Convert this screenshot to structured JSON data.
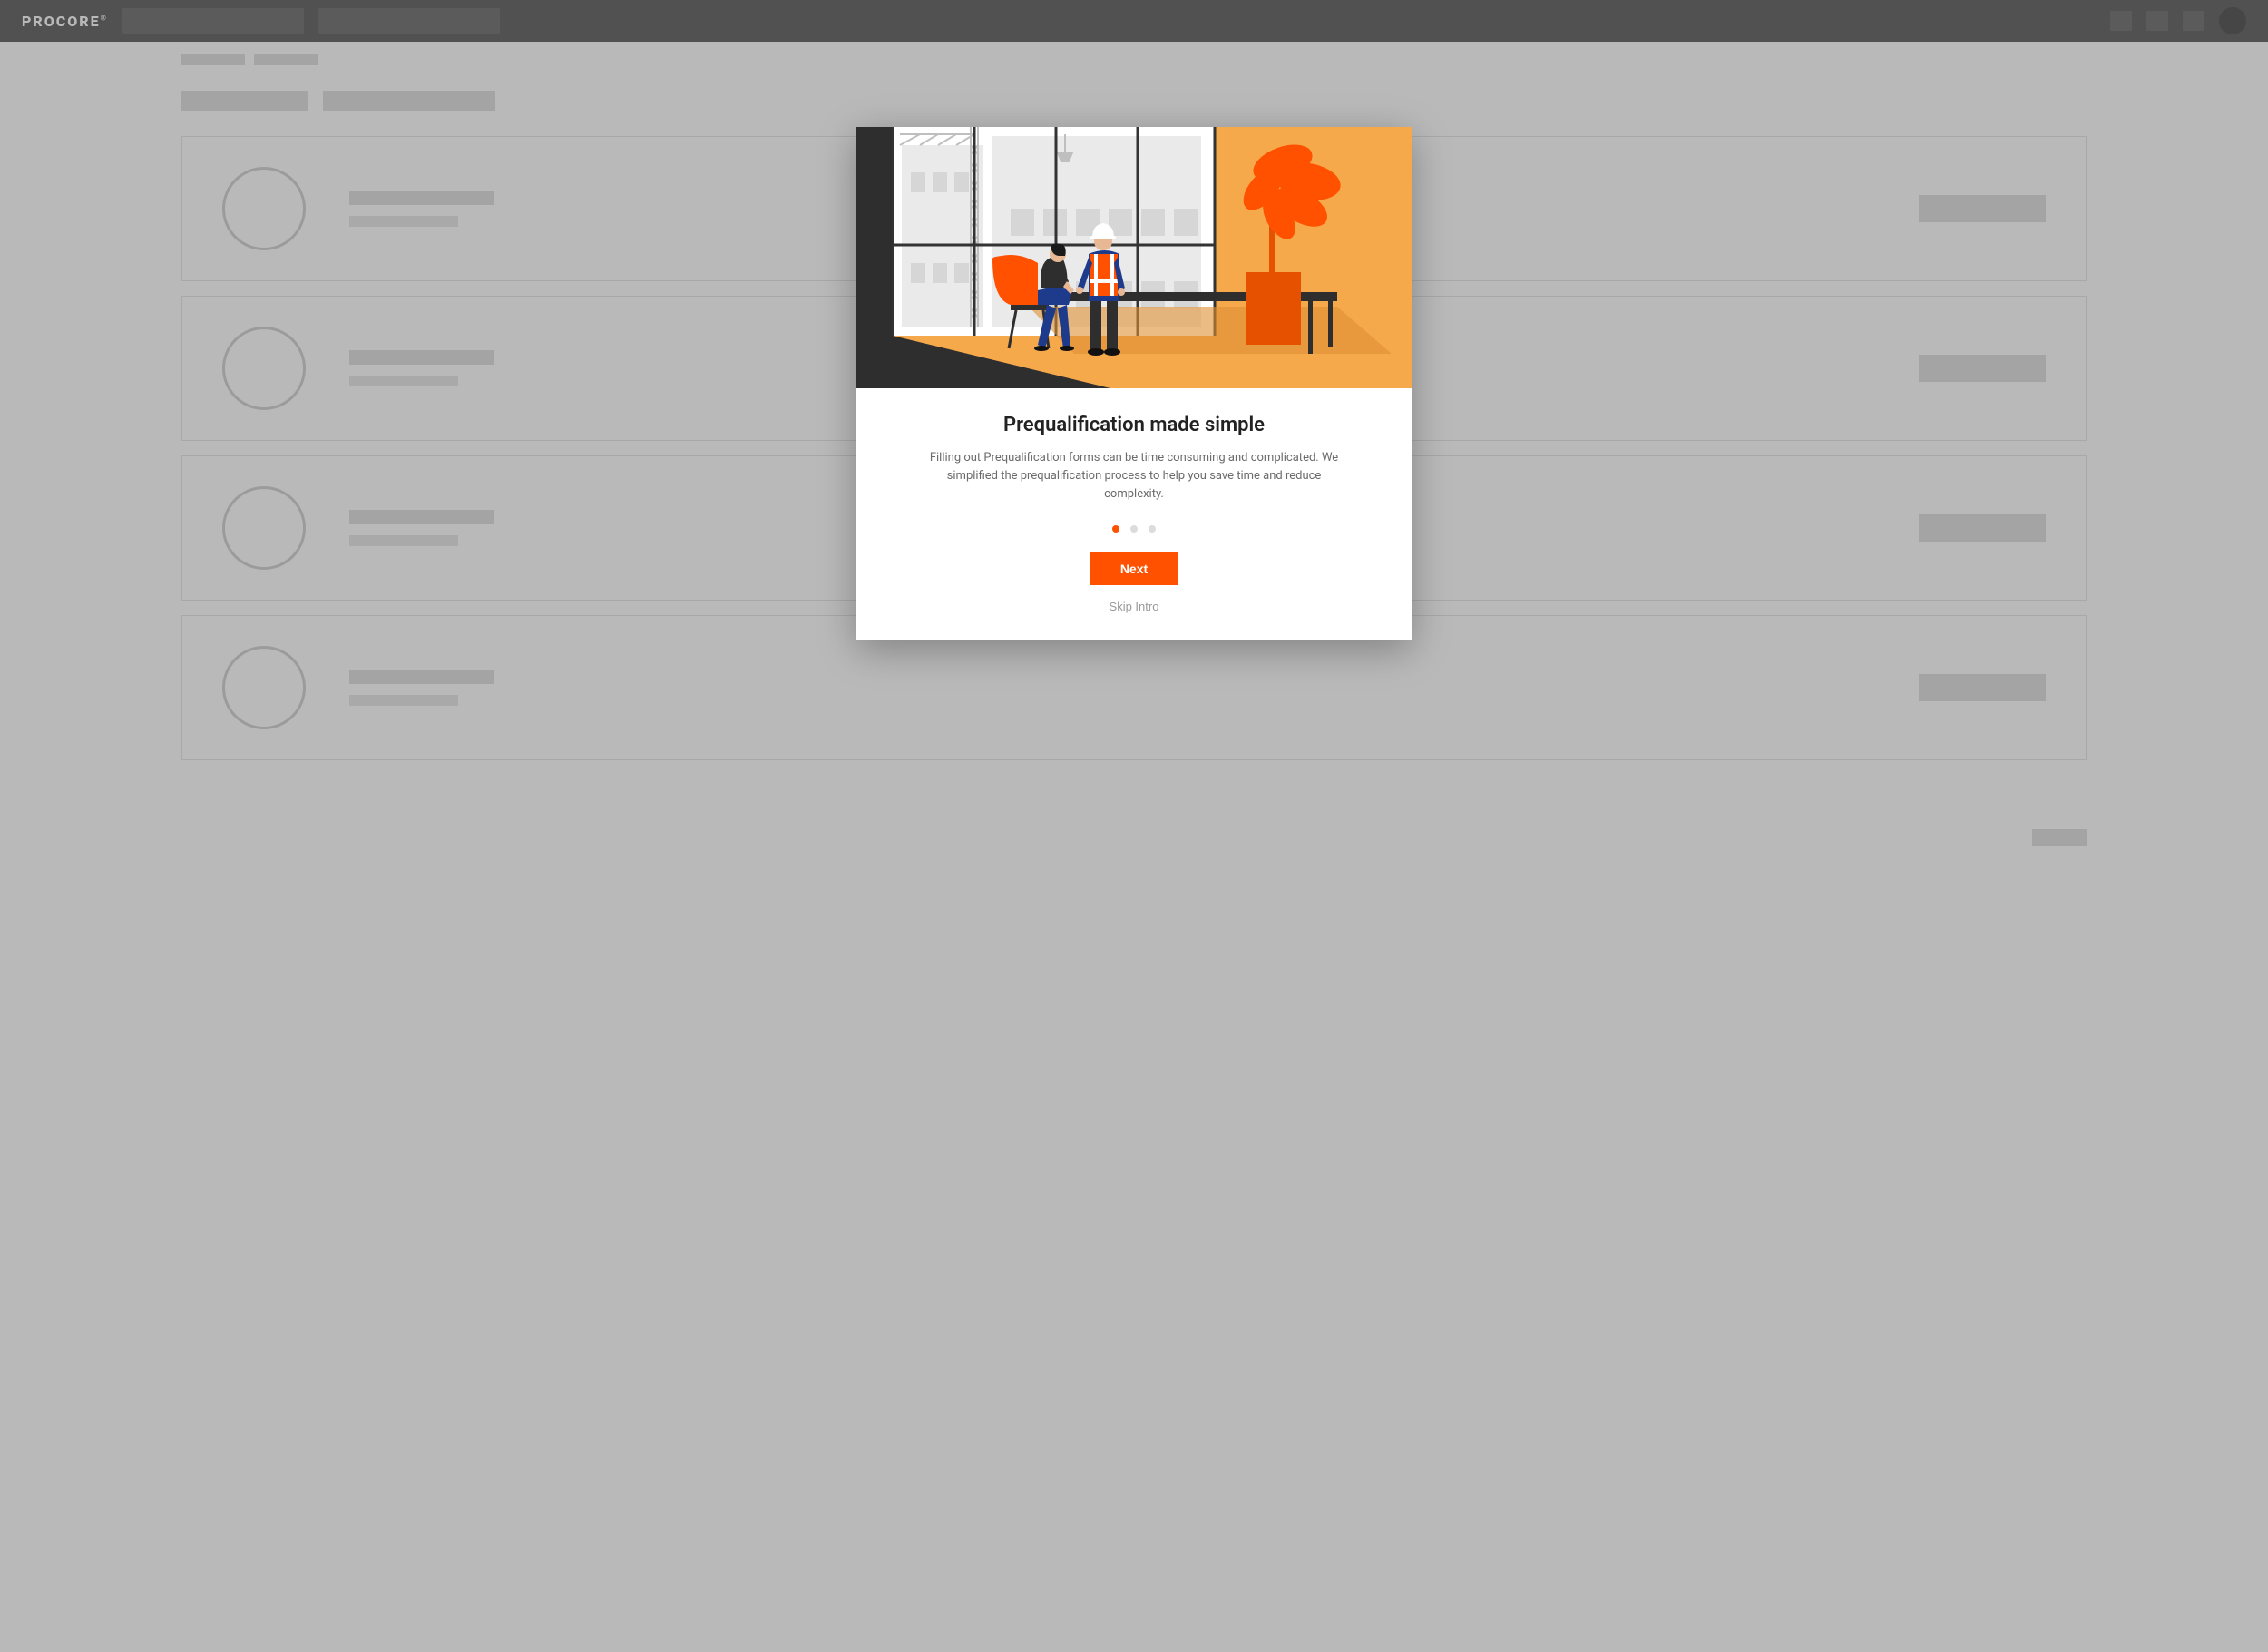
{
  "brand": "PROCORE",
  "modal": {
    "title": "Prequalification made simple",
    "description": "Filling out Prequalification forms can be time consuming and complicated. We simplified the prequalification process to help you save time and reduce complexity.",
    "next_label": "Next",
    "skip_label": "Skip Intro",
    "step_current": 1,
    "step_total": 3
  },
  "colors": {
    "accent": "#ff5100"
  }
}
